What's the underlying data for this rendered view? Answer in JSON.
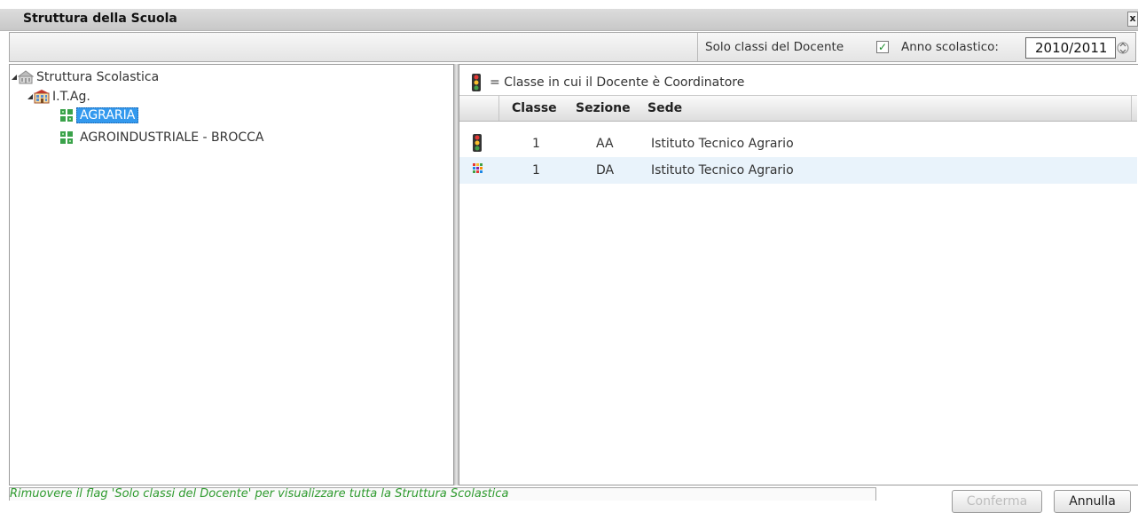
{
  "window": {
    "title": "Struttura della Scuola",
    "close_glyph": "x"
  },
  "toolbar": {
    "solo_classi_label": "Solo classi del Docente",
    "solo_classi_checked": true,
    "check_glyph": "✓",
    "anno_label": "Anno scolastico:",
    "anno_value": "2010/2011"
  },
  "tree": {
    "root": {
      "label": "Struttura Scolastica",
      "icon": "school-building-icon"
    },
    "institute": {
      "label": "I.T.Ag.",
      "icon": "institute-icon"
    },
    "items": [
      {
        "label": "AGRARIA",
        "icon": "course-icon",
        "selected": true
      },
      {
        "label": "AGROINDUSTRIALE - BROCCA",
        "icon": "course-icon",
        "selected": false
      }
    ]
  },
  "legend": {
    "icon": "traffic-light-icon",
    "text": "= Classe in cui il Docente è Coordinatore"
  },
  "grid": {
    "columns": [
      "Classe",
      "Sezione",
      "Sede"
    ],
    "rows": [
      {
        "icon": "traffic-light-icon",
        "classe": "1",
        "sezione": "AA",
        "sede": "Istituto Tecnico Agrario"
      },
      {
        "icon": "class-grid-icon",
        "classe": "1",
        "sezione": "DA",
        "sede": "Istituto Tecnico Agrario"
      }
    ]
  },
  "status": {
    "message": "Rimuovere il flag 'Solo classi del Docente' per visualizzare tutta la Struttura Scolastica"
  },
  "buttons": {
    "confirm": "Conferma",
    "cancel": "Annulla"
  },
  "colors": {
    "selection": "#3399ee",
    "status_text": "#2e9a2e",
    "row_alt": "#e9f3fb"
  }
}
